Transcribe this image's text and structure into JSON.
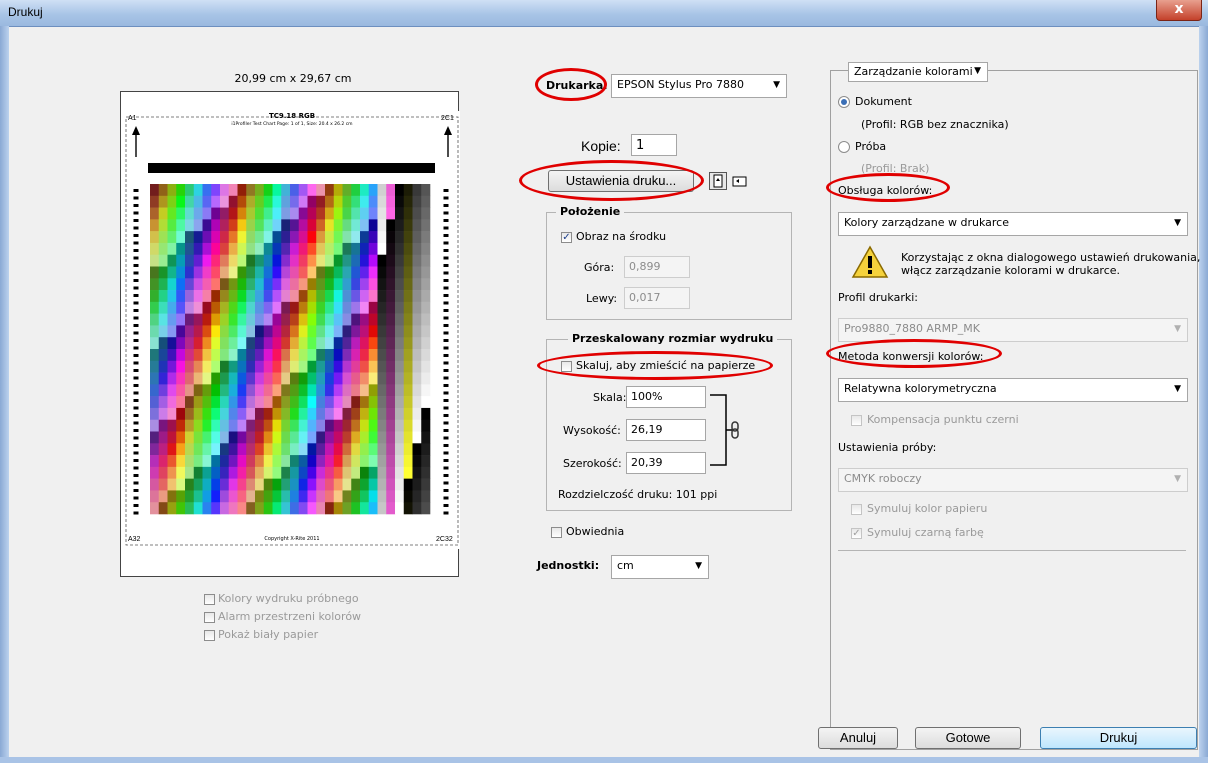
{
  "window": {
    "title": "Drukuj",
    "close_glyph": "x"
  },
  "preview": {
    "size": "20,99 cm x 29,67 cm",
    "chart_title": "TC9.18 RGB",
    "chart_subtitle": "i1Profiler Test Chart Page: 1 of 1, Size: 20.4 x 26.2 cm",
    "corner_tl": "A1",
    "corner_tr": "2C1",
    "corner_bl": "A32",
    "corner_br": "2C32",
    "copyright": "Copyright X-Rite 2011"
  },
  "left_options": [
    {
      "label": "Kolory wydruku próbnego",
      "checked": false
    },
    {
      "label": "Alarm przestrzeni kolorów",
      "checked": false
    },
    {
      "label": "Pokaż biały papier",
      "checked": false
    }
  ],
  "printer": {
    "label": "Drukarka:",
    "value": "EPSON Stylus Pro 7880"
  },
  "copies": {
    "label": "Kopie:",
    "value": "1"
  },
  "print_settings_button": "Ustawienia druku...",
  "position": {
    "legend": "Położenie",
    "center_label": "Obraz na środku",
    "center_checked": true,
    "top_label": "Góra:",
    "top_value": "0,899",
    "left_label": "Lewy:",
    "left_value": "0,017"
  },
  "scaled": {
    "legend": "Przeskalowany rozmiar wydruku",
    "fit_label": "Skaluj, aby zmieścić na papierze",
    "fit_checked": false,
    "scale_label": "Skala:",
    "scale_value": "100%",
    "height_label": "Wysokość:",
    "height_value": "26,19",
    "width_label": "Szerokość:",
    "width_value": "20,39",
    "resolution": "Rozdzielczość druku: 101 ppi"
  },
  "bounding": {
    "label": "Obwiednia",
    "checked": false
  },
  "units": {
    "label": "Jednostki:",
    "value": "cm"
  },
  "color": {
    "section": "Zarządzanie kolorami",
    "document_label": "Dokument",
    "document_profile": "(Profil: RGB bez znacznika)",
    "proof_label": "Próba",
    "proof_profile": "(Profil: Brak)",
    "handling_label": "Obsługa kolorów:",
    "handling_value": "Kolory zarządzane w drukarce",
    "warning_line1": "Korzystając z okna dialogowego ustawień drukowania,",
    "warning_line2": "włącz zarządzanie kolorami w drukarce.",
    "printer_profile_label": "Profil drukarki:",
    "printer_profile_value": "Pro9880_7880 ARMP_MK",
    "intent_label": "Metoda konwersji kolorów:",
    "intent_value": "Relatywna kolorymetryczna",
    "bpc_label": "Kompensacja punktu czerni",
    "proof_setup_label": "Ustawienia próby:",
    "proof_setup_value": "CMYK roboczy",
    "sim_paper_label": "Symuluj kolor papieru",
    "sim_ink_label": "Symuluj czarną farbę"
  },
  "buttons": {
    "cancel": "Anuluj",
    "done": "Gotowe",
    "print": "Drukuj"
  },
  "colors": {
    "accent": "#3b6fb6",
    "highlight": "#e00000"
  },
  "icons": {
    "warning": "warning-icon",
    "link": "chain-link-icon"
  }
}
